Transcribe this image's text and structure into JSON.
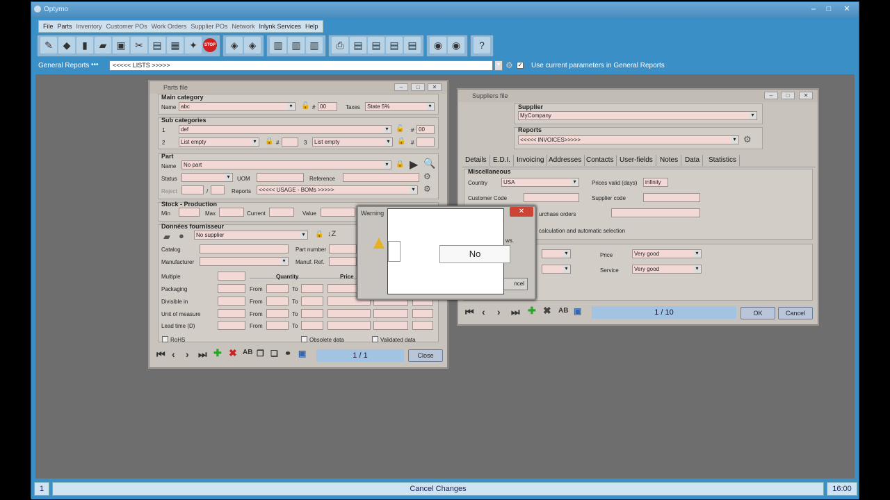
{
  "app": {
    "title": "Optymo"
  },
  "menu": [
    "File",
    "Parts",
    "Inventory",
    "Customer POs",
    "Work Orders",
    "Supplier POs",
    "Network",
    "Inlynk Services",
    "Help"
  ],
  "toolbar_icons": [
    "edit-icon",
    "inventory-icon",
    "box-icon",
    "pallet-icon",
    "machine-icon",
    "tools-icon",
    "document-icon",
    "report-icon",
    "wrench-icon",
    "stop-icon",
    "truck-icon",
    "truck2-icon",
    "barcode-icon",
    "barcode2-icon",
    "barcode3-icon",
    "printer-icon",
    "pdf-icon",
    "pdf2-icon",
    "pdf3-icon",
    "pdf4-icon",
    "database-icon",
    "server-icon",
    "help-icon"
  ],
  "stop_label": "STOP",
  "reports": {
    "label": "General Reports",
    "value": "<<<<< LISTS >>>>>",
    "use_params_label": "Use current parameters in General Reports",
    "checkmark": "✓"
  },
  "parts": {
    "title": "Parts file",
    "main_category": "Main category",
    "name_label": "Name",
    "name_value": "abc",
    "hash": "#",
    "num_value": "00",
    "taxes_label": "Taxes",
    "taxes_value": "State 5%",
    "sub_categories": "Sub categories",
    "sub1_label": "1",
    "sub1_value": "def",
    "sub1_num": "00",
    "sub2_label": "2",
    "sub2_value": "List empty",
    "sub3_label": "3",
    "sub3_value": "List empty",
    "part_section": "Part",
    "part_name_label": "Name",
    "part_name_value": "No part",
    "status_label": "Status",
    "uom_label": "UOM",
    "reference_label": "Reference",
    "reject_label": "Reject",
    "reject_sep": "/",
    "reports_label": "Reports",
    "reports_value": "<<<<< USAGE - BOMs >>>>>",
    "stock_section": "Stock - Production",
    "min_label": "Min",
    "max_label": "Max",
    "current_label": "Current",
    "value_label": "Value",
    "supplier_section": "Données fournisseur",
    "supplier_value": "No supplier",
    "catalog_label": "Catalog",
    "part_number_label": "Part number",
    "manufacturer_label": "Manufacturer",
    "manuf_ref_label": "Manuf. Ref.",
    "multiple_label": "Multiple",
    "packaging_label": "Packaging",
    "divisible_label": "Divisible in",
    "uom2_label": "Unit of measure",
    "lead_label": "Lead time (D)",
    "quantity_label": "Quantity",
    "price_label": "Price",
    "from_label": "From",
    "to_label": "To",
    "rohs_label": "RoHS",
    "obsolete_label": "Obsolete data",
    "validated_label": "Validated data",
    "counter": "1 / 1",
    "close_label": "Close"
  },
  "suppliers": {
    "title": "Suppliers file",
    "supplier_label": "Supplier",
    "supplier_value": "MyCompany",
    "reports_label": "Reports",
    "reports_value": "<<<<< INVOICES>>>>>",
    "tabs": [
      "Details",
      "E.D.I.",
      "Invoicing",
      "Addresses",
      "Contacts",
      "User-fields",
      "Notes",
      "Data",
      "Statistics"
    ],
    "misc_label": "Miscellaneous",
    "country_label": "Country",
    "country_value": "USA",
    "prices_valid_label": "Prices valid (days)",
    "prices_valid_value": "infinity",
    "customer_code_label": "Customer Code",
    "supplier_code_label": "Supplier code",
    "purchase_orders_label": "urchase orders",
    "calc_label": "calculation and automatic selection",
    "price_label": "Price",
    "price_value": "Very good",
    "service_label": "Service",
    "service_value": "Very good",
    "counter": "1 / 10",
    "ok_label": "OK",
    "cancel_label": "Cancel"
  },
  "warning": {
    "title": "Warning",
    "no_label": "No",
    "fragment_ws": "ws.",
    "fragment_e": "e.",
    "fragment_ncel": "ncel",
    "close_glyph": "✕"
  },
  "status": {
    "left": "1",
    "center": "Cancel Changes",
    "right": "16:00"
  }
}
